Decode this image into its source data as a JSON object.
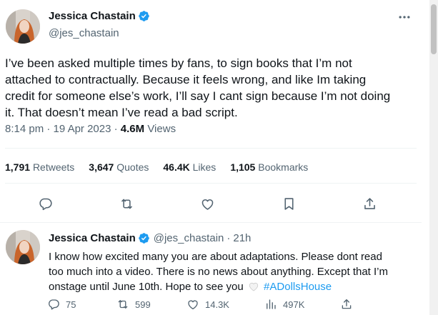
{
  "main_tweet": {
    "author": {
      "name": "Jessica Chastain",
      "handle": "@jes_chastain",
      "verified": true
    },
    "text_lines": [
      "I’ve been asked multiple times by fans, to sign books that I’m not",
      "attached to contractually. Because it feels wrong, and like Im taking",
      "credit for someone else’s work, I’ll say I cant sign because I’m not doing",
      "it. That doesn’t mean I’ve read a bad script."
    ],
    "time": "8:14 pm",
    "separator": "·",
    "date": "19 Apr 2023",
    "views_count": "4.6M",
    "views_label": "Views",
    "stats": {
      "retweets_count": "1,791",
      "retweets_label": "Retweets",
      "quotes_count": "3,647",
      "quotes_label": "Quotes",
      "likes_count": "46.4K",
      "likes_label": "Likes",
      "bookmarks_count": "1,105",
      "bookmarks_label": "Bookmarks"
    },
    "actions": [
      "reply-icon",
      "retweet-icon",
      "like-icon",
      "bookmark-icon",
      "share-icon"
    ]
  },
  "reply_tweet": {
    "author": {
      "name": "Jessica Chastain",
      "handle": "@jes_chastain",
      "separator": "·",
      "age": "21h",
      "verified": true
    },
    "text_lines": [
      "I know how excited many you are about adaptations. Please dont read",
      "too much into a video. There is no news about anything. Except that I’m",
      "onstage until June 10th. Hope to see you"
    ],
    "hashtag": "#ADollsHouse",
    "metrics": {
      "replies": "75",
      "retweets": "599",
      "likes": "14.3K",
      "views": "497K"
    }
  },
  "colors": {
    "text_primary": "#0f1419",
    "text_secondary": "#536471",
    "accent_blue": "#1d9bf0",
    "divider": "#eff3f4"
  }
}
